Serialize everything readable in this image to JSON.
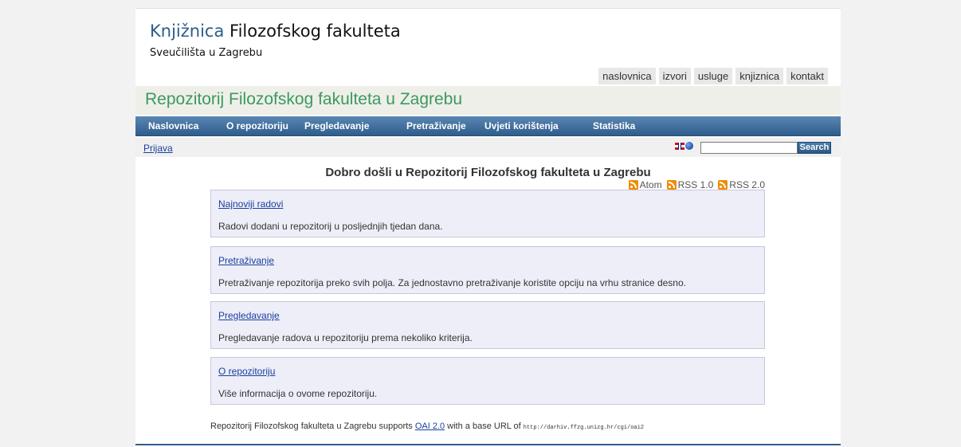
{
  "header": {
    "title_accent": "Knjižnica",
    "title_rest": "Filozofskog fakulteta",
    "subtitle": "Sveučilišta u Zagrebu"
  },
  "top_nav": [
    "naslovnica",
    "izvori",
    "usluge",
    "knjiznica",
    "kontakt"
  ],
  "repo_title": "Repozitorij Filozofskog fakulteta u Zagrebu",
  "main_menu": [
    "Naslovnica",
    "O repozitoriju",
    "Pregledavanje",
    "Pretraživanje",
    "Uvjeti korištenja",
    "Statistika"
  ],
  "toolbar": {
    "login": "Prijava",
    "search_value": "",
    "search_button": "Search"
  },
  "welcome": "Dobro došli u Repozitorij Filozofskog fakulteta u Zagrebu",
  "feeds": [
    "Atom",
    "RSS 1.0",
    "RSS 2.0"
  ],
  "sections": [
    {
      "title": "Najnoviji radovi",
      "text": "Radovi dodani u repozitorij u posljednjih tjedan dana."
    },
    {
      "title": "Pretraživanje",
      "text": "Pretraživanje repozitorija preko svih polja. Za jednostavno pretraživanje koristite opciju na vrhu stranice desno."
    },
    {
      "title": "Pregledavanje",
      "text": "Pregledavanje radova u repozitoriju prema nekoliko kriterija."
    },
    {
      "title": "O repozitoriju",
      "text": "Više informacija o ovome repozitoriju."
    }
  ],
  "footer": {
    "prefix": "Repozitorij Filozofskog fakulteta u Zagrebu supports",
    "link": "OAI 2.0",
    "middle": "with a base URL of",
    "url": "http://darhiv.ffzg.unizg.hr/cgi/oai2"
  },
  "colors": {
    "accent_blue": "#2b5e8c",
    "repo_green": "#3b9a5f",
    "menu_blue": "#2f5d8c",
    "link_blue": "#1a3f9e",
    "box_bg": "#eeeef8",
    "rss_orange": "#f08c00"
  }
}
